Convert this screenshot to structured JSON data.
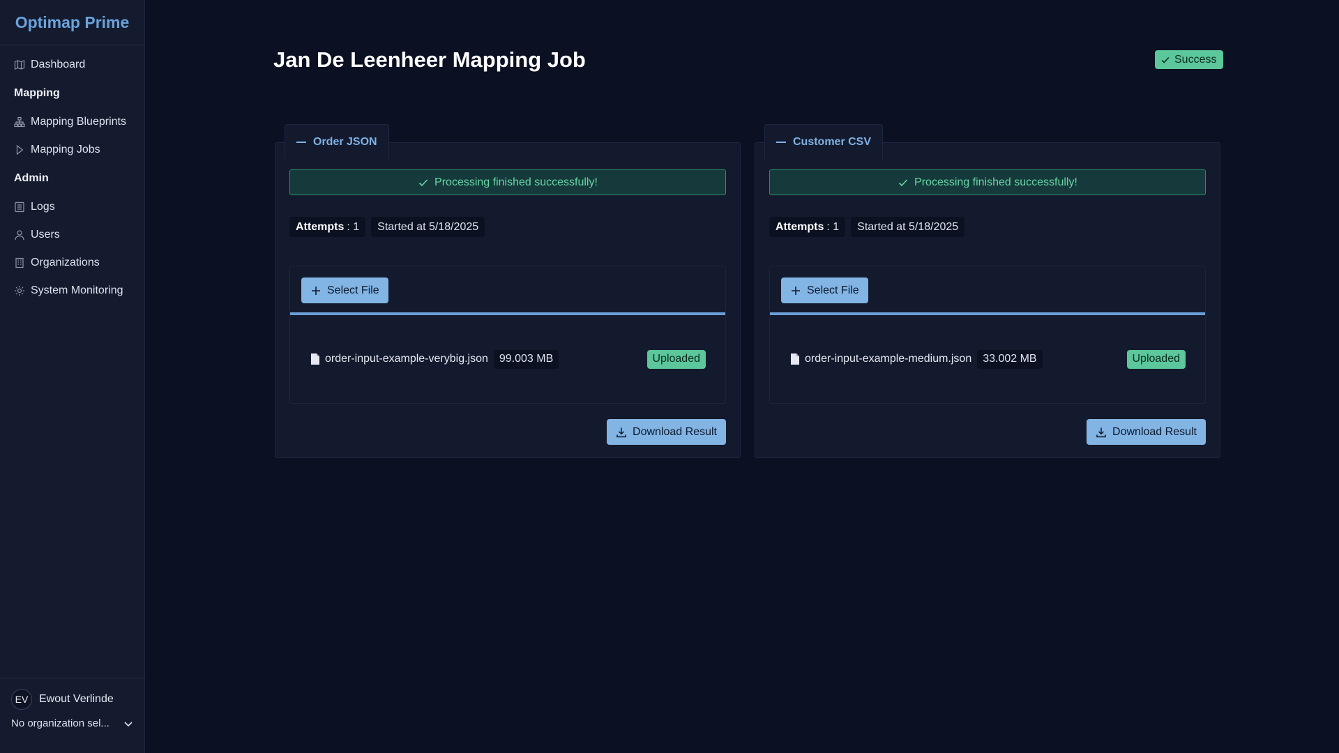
{
  "app": {
    "brand": "Optimap Prime"
  },
  "sidebar": {
    "items": [
      {
        "label": "Dashboard",
        "icon": "map-icon"
      },
      {
        "section": "Mapping"
      },
      {
        "label": "Mapping Blueprints",
        "icon": "sitemap-icon"
      },
      {
        "label": "Mapping Jobs",
        "icon": "play-icon"
      },
      {
        "section": "Admin"
      },
      {
        "label": "Logs",
        "icon": "list-icon"
      },
      {
        "label": "Users",
        "icon": "user-icon"
      },
      {
        "label": "Organizations",
        "icon": "building-icon"
      },
      {
        "label": "System Monitoring",
        "icon": "cog-icon"
      }
    ],
    "user": {
      "initials": "EV",
      "name": "Ewout Verlinde"
    },
    "organization_select": "No organization sel..."
  },
  "page": {
    "title": "Jan De Leenheer Mapping Job",
    "status": "Success"
  },
  "panels": [
    {
      "legend": "Order JSON",
      "message": "Processing finished successfully!",
      "attempts_label": "Attempts",
      "attempts_value": ": 1",
      "started": "Started at 5/18/2025",
      "select_file_label": "Select File",
      "file": {
        "name": "order-input-example-verybig.json",
        "size": "99.003 MB",
        "status": "Uploaded"
      },
      "download_label": "Download Result"
    },
    {
      "legend": "Customer CSV",
      "message": "Processing finished successfully!",
      "attempts_label": "Attempts",
      "attempts_value": ": 1",
      "started": "Started at 5/18/2025",
      "select_file_label": "Select File",
      "file": {
        "name": "order-input-example-medium.json",
        "size": "33.002 MB",
        "status": "Uploaded"
      },
      "download_label": "Download Result"
    }
  ],
  "colors": {
    "background": "#0b1023",
    "sidebar": "#151b2e",
    "accent": "#82b4e4",
    "success": "#5bc79a"
  }
}
